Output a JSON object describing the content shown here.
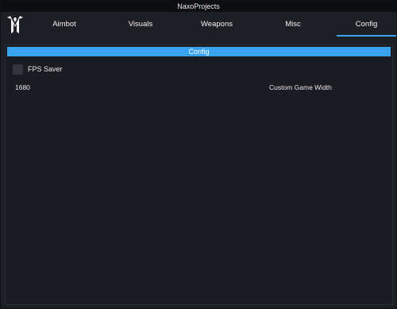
{
  "window": {
    "title": "NaxoProjects"
  },
  "logo": {
    "icon": "naxo-logo-icon"
  },
  "tabs": [
    {
      "label": "Aimbot",
      "active": false
    },
    {
      "label": "Visuals",
      "active": false
    },
    {
      "label": "Weapons",
      "active": false
    },
    {
      "label": "Misc",
      "active": false
    },
    {
      "label": "Config",
      "active": true
    }
  ],
  "config": {
    "header": "Config",
    "fps_saver": {
      "label": "FPS Saver",
      "checked": false
    },
    "custom_game_width": {
      "value": "1680",
      "label": "Custom Game Width"
    }
  },
  "colors": {
    "accent": "#3aa3f0",
    "background": "#1e1f24",
    "titlebar": "#0c0d10",
    "checkbox": "#35363d"
  }
}
